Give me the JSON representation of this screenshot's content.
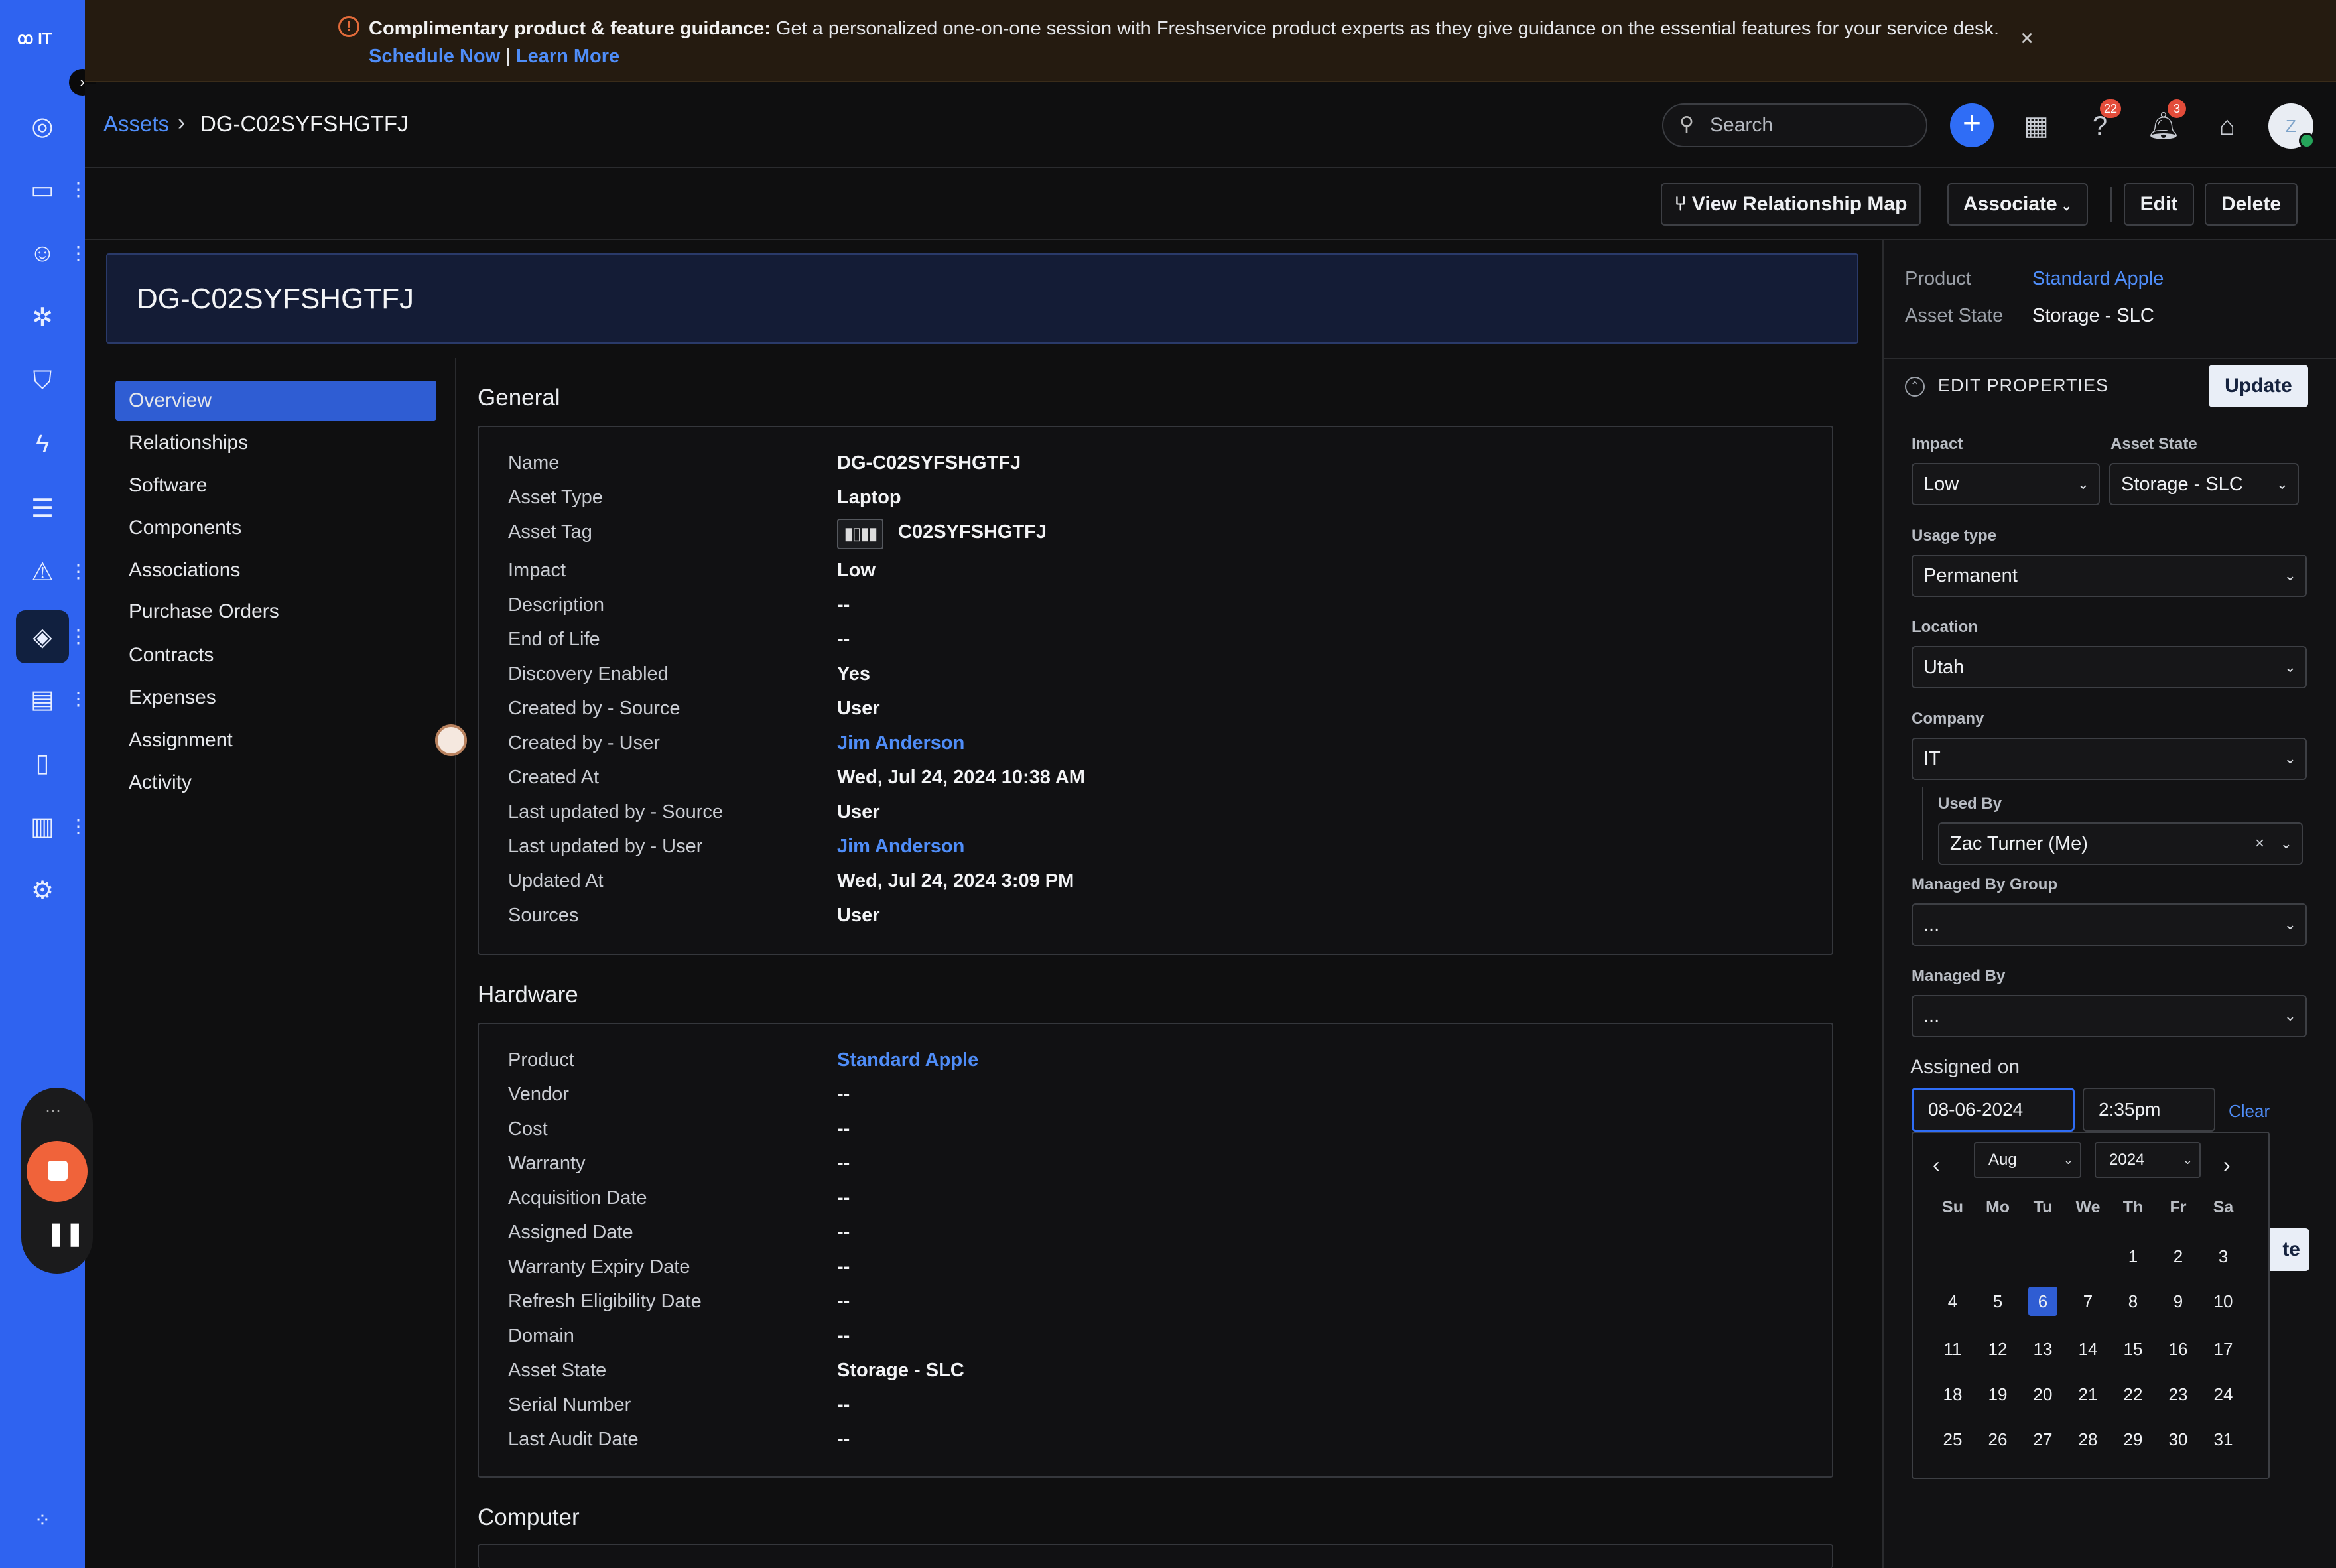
{
  "rail": {
    "logo": "IT",
    "icons": [
      "dashboard-icon",
      "tickets-icon",
      "contacts-icon",
      "problems-icon",
      "changes-icon",
      "releases-icon",
      "tasks-icon",
      "alerts-icon",
      "assets-icon",
      "purchase-icon",
      "solutions-icon",
      "reports-icon",
      "admin-icon"
    ]
  },
  "banner": {
    "bold": "Complimentary product & feature guidance:",
    "text": " Get a personalized one-on-one session with Freshservice product experts as they give guidance on the essential features for your service desk.",
    "schedule": "Schedule Now",
    "sep": " | ",
    "learn": "Learn More",
    "close": "×"
  },
  "breadcrumb": {
    "parent": "Assets",
    "sep": "›",
    "current": "DG-C02SYFSHGTFJ"
  },
  "header": {
    "search_placeholder": "Search",
    "help_badge": "22",
    "notif_badge": "3",
    "avatar": "Z"
  },
  "toolbar": {
    "relationship": "View Relationship Map",
    "associate": "Associate",
    "edit": "Edit",
    "delete": "Delete"
  },
  "title": "DG-C02SYFSHGTFJ",
  "nav": [
    "Overview",
    "Relationships",
    "Software",
    "Components",
    "Associations",
    "Purchase Orders",
    "Contracts",
    "Expenses",
    "Assignment",
    "Activity"
  ],
  "general": {
    "title": "General",
    "rows": [
      {
        "label": "Name",
        "value": "DG-C02SYFSHGTFJ"
      },
      {
        "label": "Asset Type",
        "value": "Laptop"
      },
      {
        "label": "Asset Tag",
        "value": "C02SYFSHGTFJ"
      },
      {
        "label": "Impact",
        "value": "Low"
      },
      {
        "label": "Description",
        "value": "--"
      },
      {
        "label": "End of Life",
        "value": "--"
      },
      {
        "label": "Discovery Enabled",
        "value": "Yes"
      },
      {
        "label": "Created by - Source",
        "value": "User"
      },
      {
        "label": "Created by - User",
        "value": "Jim Anderson"
      },
      {
        "label": "Created At",
        "value": "Wed, Jul 24, 2024 10:38 AM"
      },
      {
        "label": "Last updated by - Source",
        "value": "User"
      },
      {
        "label": "Last updated by - User",
        "value": "Jim Anderson"
      },
      {
        "label": "Updated At",
        "value": "Wed, Jul 24, 2024 3:09 PM"
      },
      {
        "label": "Sources",
        "value": "User"
      }
    ]
  },
  "hardware": {
    "title": "Hardware",
    "rows": [
      {
        "label": "Product",
        "value": "Standard Apple"
      },
      {
        "label": "Vendor",
        "value": "--"
      },
      {
        "label": "Cost",
        "value": "--"
      },
      {
        "label": "Warranty",
        "value": "--"
      },
      {
        "label": "Acquisition Date",
        "value": "--"
      },
      {
        "label": "Assigned Date",
        "value": "--"
      },
      {
        "label": "Warranty Expiry Date",
        "value": "--"
      },
      {
        "label": "Refresh Eligibility Date",
        "value": "--"
      },
      {
        "label": "Domain",
        "value": "--"
      },
      {
        "label": "Asset State",
        "value": "Storage - SLC"
      },
      {
        "label": "Serial Number",
        "value": "--"
      },
      {
        "label": "Last Audit Date",
        "value": "--"
      }
    ]
  },
  "computer": {
    "title": "Computer"
  },
  "right_panel": {
    "product_label": "Product",
    "product_value": "Standard Apple",
    "state_label": "Asset State",
    "state_value": "Storage - SLC",
    "edit_title": "EDIT PROPERTIES",
    "update": "Update",
    "impact_label": "Impact",
    "impact_value": "Low",
    "asset_state_label": "Asset State",
    "asset_state_value": "Storage - SLC",
    "usage_label": "Usage type",
    "usage_value": "Permanent",
    "location_label": "Location",
    "location_value": "Utah",
    "company_label": "Company",
    "company_value": "IT",
    "used_by_label": "Used By",
    "used_by_value": "Zac Turner (Me)",
    "managed_group_label": "Managed By Group",
    "managed_group_value": "...",
    "managed_by_label": "Managed By",
    "managed_by_value": "...",
    "assigned_label": "Assigned on",
    "assigned_date": "08-06-2024",
    "assigned_time": "2:35pm",
    "clear": "Clear",
    "hidden_update": "te"
  },
  "calendar": {
    "month": "Aug",
    "year": "2024",
    "dow": [
      "Su",
      "Mo",
      "Tu",
      "We",
      "Th",
      "Fr",
      "Sa"
    ],
    "selected": 6,
    "first_weekday": 4,
    "days": 31
  }
}
